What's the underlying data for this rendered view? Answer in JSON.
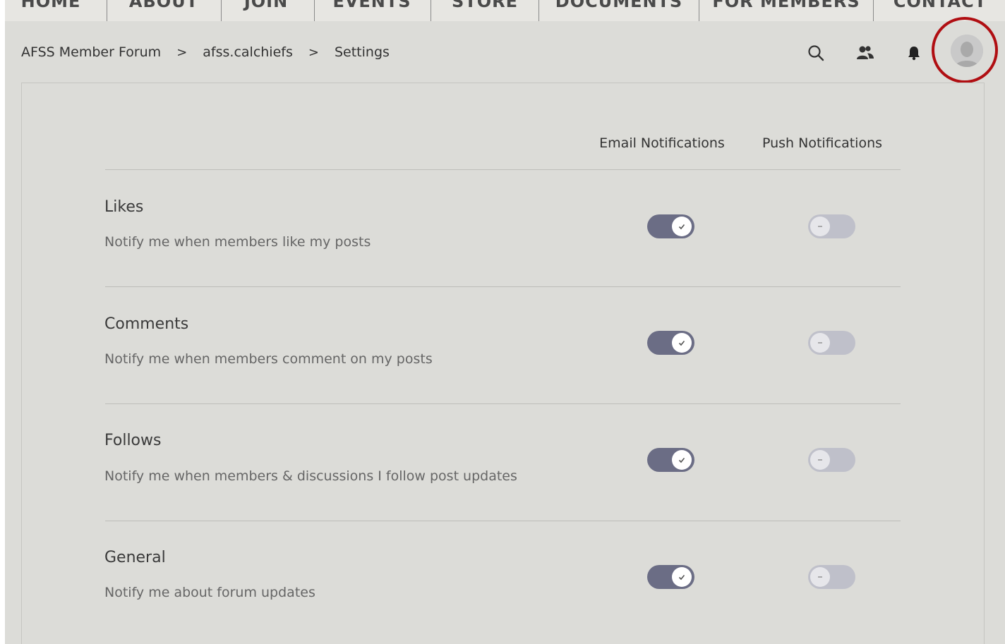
{
  "top_nav": [
    "HOME",
    "ABOUT",
    "JOIN",
    "EVENTS",
    "STORE",
    "DOCUMENTS",
    "FOR MEMBERS",
    "CONTACT"
  ],
  "breadcrumb": {
    "root": "AFSS Member Forum",
    "user": "afss.calchiefs",
    "current": "Settings"
  },
  "header_icons": [
    "search-icon",
    "members-icon",
    "bell-icon"
  ],
  "columns": {
    "email": "Email Notifications",
    "push": "Push Notifications"
  },
  "rows": [
    {
      "title": "Likes",
      "desc": "Notify me when members like my posts",
      "email_on": true,
      "push_on": false
    },
    {
      "title": "Comments",
      "desc": "Notify me when members comment on my posts",
      "email_on": true,
      "push_on": false
    },
    {
      "title": "Follows",
      "desc": "Notify me when members & discussions I follow post updates",
      "email_on": true,
      "push_on": false
    },
    {
      "title": "General",
      "desc": "Notify me about forum updates",
      "email_on": true,
      "push_on": false
    }
  ],
  "colors": {
    "toggle_on": "#6b6d85",
    "toggle_off": "#bfc0ca",
    "highlight": "#b00e12",
    "background": "#dcdcd8"
  }
}
